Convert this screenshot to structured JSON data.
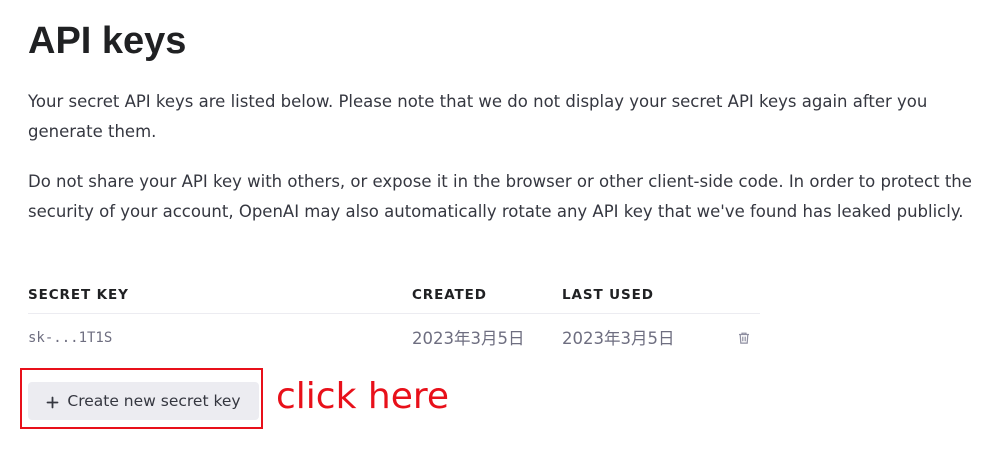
{
  "page": {
    "title": "API keys",
    "description_1": "Your secret API keys are listed below. Please note that we do not display your secret API keys again after you generate them.",
    "description_2": "Do not share your API key with others, or expose it in the browser or other client-side code. In order to protect the security of your account, OpenAI may also automatically rotate any API key that we've found has leaked publicly."
  },
  "table": {
    "headers": {
      "secret_key": "SECRET KEY",
      "created": "CREATED",
      "last_used": "LAST USED"
    },
    "rows": [
      {
        "secret_key": "sk-...1T1S",
        "created": "2023年3月5日",
        "last_used": "2023年3月5日",
        "action_icon": "trash-icon"
      }
    ]
  },
  "actions": {
    "create_label": "Create new secret key",
    "create_icon": "plus-icon"
  },
  "annotation": {
    "text": "click here",
    "color": "#e8101a"
  },
  "colors": {
    "button_bg": "#ececf1",
    "text_primary": "#202123",
    "text_muted": "#6e6e80"
  }
}
